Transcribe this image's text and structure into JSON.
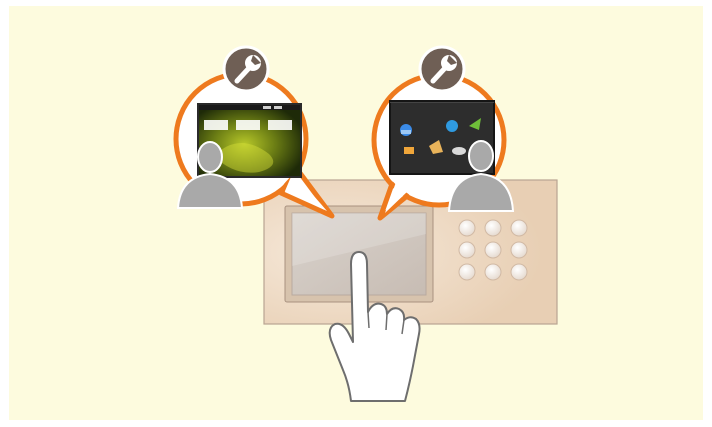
{
  "illustration": {
    "background_color": "#fdfbde",
    "bubble_ring_color": "#ee7a1e",
    "wrench_badge_color": "#6f5f55",
    "user_silhouette_color": "#a9a9a9",
    "device_color": "#ead1b8",
    "keypad_button_count": 9,
    "bubbles": [
      {
        "name": "user-settings-bubble-left",
        "screen_theme": "green-abstract-wallpaper",
        "icons": [
          "wrench-icon",
          "user-icon"
        ]
      },
      {
        "name": "user-settings-bubble-right",
        "screen_theme": "dark-menu-with-app-icons",
        "icons": [
          "wrench-icon",
          "user-icon"
        ]
      }
    ]
  }
}
